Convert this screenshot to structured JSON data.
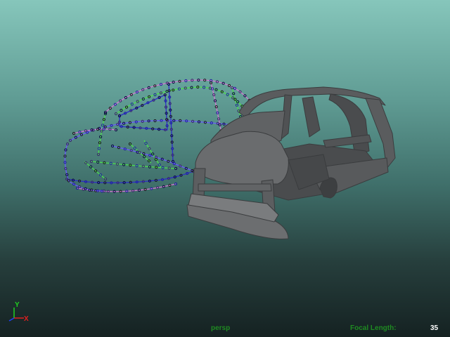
{
  "viewport": {
    "camera_name": "persp",
    "focal_length_label": "Focal Length:",
    "focal_length_value": "35"
  },
  "axis_gizmo": {
    "x_label": "X",
    "y_label": "Y",
    "x_color": "#e02020",
    "y_color": "#20d020",
    "z_color": "#2040ff"
  },
  "colors": {
    "background_top": "#86c6bb",
    "background_bottom": "#152222",
    "body_mesh": "#57595b",
    "hud_label": "#1f8a22",
    "hud_value": "#ffffff"
  }
}
